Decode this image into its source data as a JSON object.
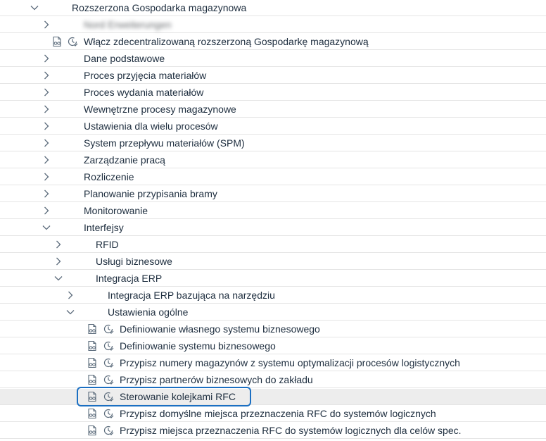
{
  "tree": {
    "root": {
      "label": "Rozszerzona Gospodarka magazynowa"
    },
    "blurred_item": {
      "label": "Nord Erweiterungen"
    },
    "activate_item": {
      "label": "Włącz zdecentralizowaną rozszerzoną Gospodarkę magazynową"
    },
    "level1": [
      "Dane podstawowe",
      "Proces przyjęcia materiałów",
      "Proces wydania materiałów",
      "Wewnętrzne procesy magazynowe",
      "Ustawienia dla wielu procesów",
      "System przepływu materiałów (SPM)",
      "Zarządzanie pracą",
      "Rozliczenie",
      "Planowanie przypisania bramy",
      "Monitorowanie",
      "Interfejsy"
    ],
    "interfaces_children": [
      "RFID",
      "Usługi biznesowe",
      "Integracja ERP"
    ],
    "erp_children": [
      "Integracja ERP bazująca na narzędziu",
      "Ustawienia ogólne"
    ],
    "general_settings_items": [
      "Definiowanie własnego systemu biznesowego",
      "Definiowanie systemu biznesowego",
      "Przypisz numery magazynów z systemu optymalizacji procesów logistycznych",
      "Przypisz partnerów biznesowych do zakładu",
      "Sterowanie kolejkami RFC",
      "Przypisz domyślne miejsca przeznaczenia RFC do systemów logicznych",
      "Przypisz miejsca przeznaczenia RFC do systemów logicznych dla celów spec."
    ],
    "selected_item": "Sterowanie kolejkami RFC"
  },
  "icons": {
    "expand": "chevron-right-icon",
    "collapse": "chevron-down-icon",
    "document": "document-glasses-icon",
    "execute": "clock-check-icon"
  },
  "colors": {
    "highlight_border": "#1b6fc2",
    "selected_row": "#ededed",
    "text": "#1d2d3e",
    "icon": "#5b6b7b"
  }
}
